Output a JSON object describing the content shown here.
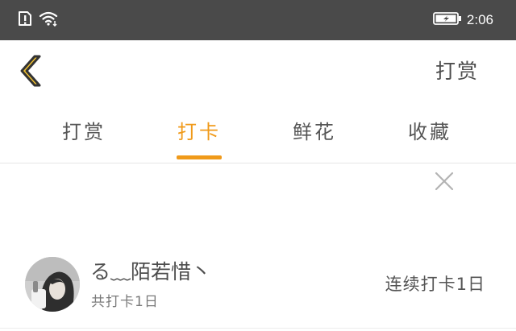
{
  "status_bar": {
    "time": "2:06",
    "icons": [
      "alert-icon",
      "wifi-icon",
      "battery-charging-icon"
    ]
  },
  "header": {
    "back_icon": "chevron-left-icon",
    "action_label": "打赏"
  },
  "tabs": [
    {
      "label": "打赏",
      "active": false
    },
    {
      "label": "打卡",
      "active": true
    },
    {
      "label": "鲜花",
      "active": false
    },
    {
      "label": "收藏",
      "active": false
    }
  ],
  "close_icon": "close-icon",
  "list": [
    {
      "name": "る﹏陌若惜丶",
      "total": "共打卡1日",
      "streak": "连续打卡1日"
    }
  ],
  "colors": {
    "status_bar_bg": "#4a4a4a",
    "accent": "#f09a1a",
    "back_icon_fill": "#f2c230",
    "text_primary": "#4d4d4d",
    "text_secondary": "#7a7a7a",
    "divider": "#e6e6e6"
  }
}
